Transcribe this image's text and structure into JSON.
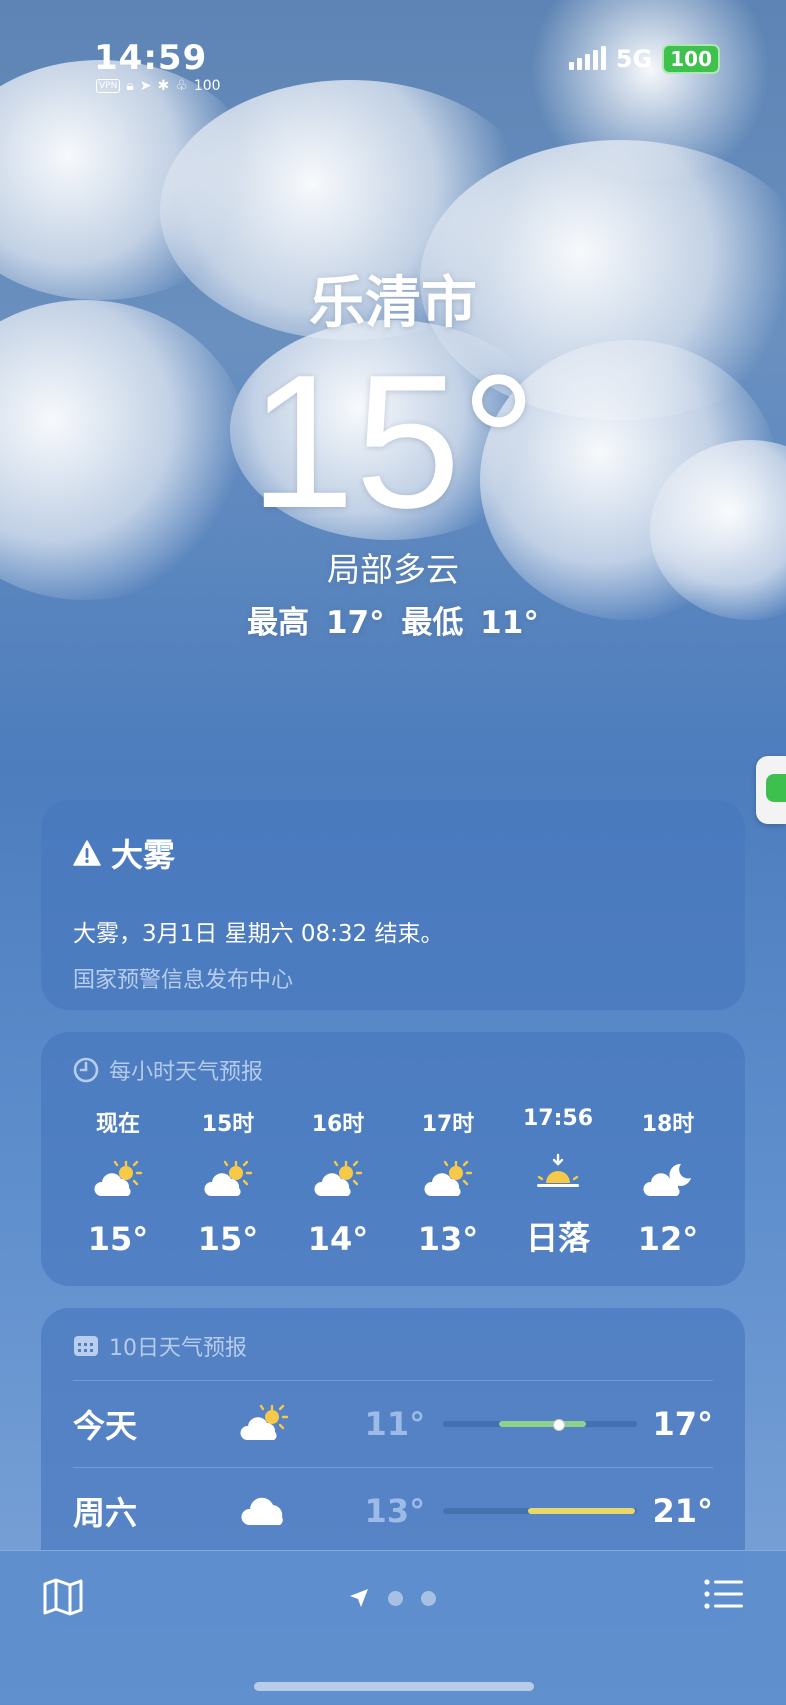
{
  "status": {
    "time": "14:59",
    "vpn": "VPN",
    "small_battery": "100",
    "network": "5G",
    "battery": "100"
  },
  "hero": {
    "city": "乐清市",
    "temperature": "15°",
    "condition": "局部多云",
    "high_low": "最高 17° 最低 11°"
  },
  "alert": {
    "title": "大雾",
    "body": "大雾，3月1日 星期六 08:32 结束。",
    "source": "国家预警信息发布中心"
  },
  "hourly": {
    "header": "每小时天气预报",
    "items": [
      {
        "label": "现在",
        "icon": "partly-cloudy-icon",
        "value": "15°"
      },
      {
        "label": "15时",
        "icon": "partly-cloudy-icon",
        "value": "15°"
      },
      {
        "label": "16时",
        "icon": "partly-cloudy-icon",
        "value": "14°"
      },
      {
        "label": "17时",
        "icon": "partly-cloudy-icon",
        "value": "13°"
      },
      {
        "label": "17:56",
        "icon": "sunset-icon",
        "value": "日落"
      },
      {
        "label": "18时",
        "icon": "cloudy-night-icon",
        "value": "12°"
      }
    ]
  },
  "daily": {
    "header": "10日天气预报",
    "days": [
      {
        "name": "今天",
        "icon": "partly-cloudy-icon",
        "low": "11°",
        "high": "17°",
        "range_start": 0.28,
        "range_end": 0.72,
        "current": 0.58,
        "color": "#8fd18a"
      },
      {
        "name": "周六",
        "icon": "cloud-icon",
        "low": "13°",
        "high": "21°",
        "range_start": 0.43,
        "range_end": 0.97,
        "color": "#e8d86a"
      }
    ]
  },
  "colors": {
    "sun": "#f7c948",
    "battery": "#3fc14d"
  }
}
